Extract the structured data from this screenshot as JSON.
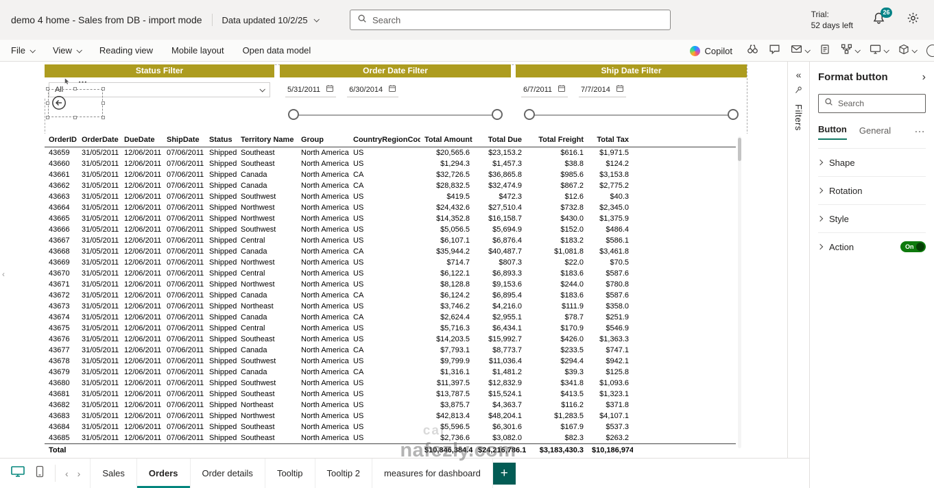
{
  "topbar": {
    "title": "demo 4 home - Sales from DB - import mode",
    "data_updated_label": "Data updated 10/2/25",
    "search_placeholder": "Search",
    "trial_line1": "Trial:",
    "trial_line2": "52 days left",
    "notification_count": "26"
  },
  "menubar": {
    "items": [
      {
        "label": "File",
        "dropdown": true
      },
      {
        "label": "View",
        "dropdown": true
      },
      {
        "label": "Reading view",
        "dropdown": false
      },
      {
        "label": "Mobile layout",
        "dropdown": false
      },
      {
        "label": "Open data model",
        "dropdown": false
      }
    ],
    "copilot_label": "Copilot"
  },
  "canvas": {
    "slicers": [
      {
        "title": "Status Filter",
        "value": "All"
      },
      {
        "title": "Order Date Filter",
        "start": "5/31/2011",
        "end": "6/30/2014"
      },
      {
        "title": "Ship Date Filter",
        "start": "6/7/2011",
        "end": "7/7/2014"
      }
    ],
    "table": {
      "columns": [
        "OrderID",
        "OrderDate",
        "DueDate",
        "ShipDate",
        "Status",
        "Territory Name",
        "Group",
        "CountryRegionCode",
        "Total Amount",
        "Total Due",
        "Total Freight",
        "Total Tax"
      ],
      "rows": [
        [
          "43659",
          "31/05/2011",
          "12/06/2011",
          "07/06/2011",
          "Shipped",
          "Southeast",
          "North America",
          "US",
          "$20,565.6",
          "$23,153.2",
          "$616.1",
          "$1,971.5"
        ],
        [
          "43660",
          "31/05/2011",
          "12/06/2011",
          "07/06/2011",
          "Shipped",
          "Southeast",
          "North America",
          "US",
          "$1,294.3",
          "$1,457.3",
          "$38.8",
          "$124.2"
        ],
        [
          "43661",
          "31/05/2011",
          "12/06/2011",
          "07/06/2011",
          "Shipped",
          "Canada",
          "North America",
          "CA",
          "$32,726.5",
          "$36,865.8",
          "$985.6",
          "$3,153.8"
        ],
        [
          "43662",
          "31/05/2011",
          "12/06/2011",
          "07/06/2011",
          "Shipped",
          "Canada",
          "North America",
          "CA",
          "$28,832.5",
          "$32,474.9",
          "$867.2",
          "$2,775.2"
        ],
        [
          "43663",
          "31/05/2011",
          "12/06/2011",
          "07/06/2011",
          "Shipped",
          "Southwest",
          "North America",
          "US",
          "$419.5",
          "$472.3",
          "$12.6",
          "$40.3"
        ],
        [
          "43664",
          "31/05/2011",
          "12/06/2011",
          "07/06/2011",
          "Shipped",
          "Northwest",
          "North America",
          "US",
          "$24,432.6",
          "$27,510.4",
          "$732.8",
          "$2,345.0"
        ],
        [
          "43665",
          "31/05/2011",
          "12/06/2011",
          "07/06/2011",
          "Shipped",
          "Northwest",
          "North America",
          "US",
          "$14,352.8",
          "$16,158.7",
          "$430.0",
          "$1,375.9"
        ],
        [
          "43666",
          "31/05/2011",
          "12/06/2011",
          "07/06/2011",
          "Shipped",
          "Southwest",
          "North America",
          "US",
          "$5,056.5",
          "$5,694.9",
          "$152.0",
          "$486.4"
        ],
        [
          "43667",
          "31/05/2011",
          "12/06/2011",
          "07/06/2011",
          "Shipped",
          "Central",
          "North America",
          "US",
          "$6,107.1",
          "$6,876.4",
          "$183.2",
          "$586.1"
        ],
        [
          "43668",
          "31/05/2011",
          "12/06/2011",
          "07/06/2011",
          "Shipped",
          "Canada",
          "North America",
          "CA",
          "$35,944.2",
          "$40,487.7",
          "$1,081.8",
          "$3,461.8"
        ],
        [
          "43669",
          "31/05/2011",
          "12/06/2011",
          "07/06/2011",
          "Shipped",
          "Northwest",
          "North America",
          "US",
          "$714.7",
          "$807.3",
          "$22.0",
          "$70.5"
        ],
        [
          "43670",
          "31/05/2011",
          "12/06/2011",
          "07/06/2011",
          "Shipped",
          "Central",
          "North America",
          "US",
          "$6,122.1",
          "$6,893.3",
          "$183.6",
          "$587.6"
        ],
        [
          "43671",
          "31/05/2011",
          "12/06/2011",
          "07/06/2011",
          "Shipped",
          "Northwest",
          "North America",
          "US",
          "$8,128.8",
          "$9,153.6",
          "$244.0",
          "$780.8"
        ],
        [
          "43672",
          "31/05/2011",
          "12/06/2011",
          "07/06/2011",
          "Shipped",
          "Canada",
          "North America",
          "CA",
          "$6,124.2",
          "$6,895.4",
          "$183.6",
          "$587.6"
        ],
        [
          "43673",
          "31/05/2011",
          "12/06/2011",
          "07/06/2011",
          "Shipped",
          "Northeast",
          "North America",
          "US",
          "$3,746.2",
          "$4,216.0",
          "$111.9",
          "$358.0"
        ],
        [
          "43674",
          "31/05/2011",
          "12/06/2011",
          "07/06/2011",
          "Shipped",
          "Canada",
          "North America",
          "CA",
          "$2,624.4",
          "$2,955.1",
          "$78.7",
          "$251.9"
        ],
        [
          "43675",
          "31/05/2011",
          "12/06/2011",
          "07/06/2011",
          "Shipped",
          "Central",
          "North America",
          "US",
          "$5,716.3",
          "$6,434.1",
          "$170.9",
          "$546.9"
        ],
        [
          "43676",
          "31/05/2011",
          "12/06/2011",
          "07/06/2011",
          "Shipped",
          "Southeast",
          "North America",
          "US",
          "$14,203.5",
          "$15,992.7",
          "$426.0",
          "$1,363.3"
        ],
        [
          "43677",
          "31/05/2011",
          "12/06/2011",
          "07/06/2011",
          "Shipped",
          "Canada",
          "North America",
          "CA",
          "$7,793.1",
          "$8,773.7",
          "$233.5",
          "$747.1"
        ],
        [
          "43678",
          "31/05/2011",
          "12/06/2011",
          "07/06/2011",
          "Shipped",
          "Southwest",
          "North America",
          "US",
          "$9,799.9",
          "$11,036.4",
          "$294.4",
          "$942.1"
        ],
        [
          "43679",
          "31/05/2011",
          "12/06/2011",
          "07/06/2011",
          "Shipped",
          "Canada",
          "North America",
          "CA",
          "$1,316.1",
          "$1,481.2",
          "$39.3",
          "$125.8"
        ],
        [
          "43680",
          "31/05/2011",
          "12/06/2011",
          "07/06/2011",
          "Shipped",
          "Southwest",
          "North America",
          "US",
          "$11,397.5",
          "$12,832.9",
          "$341.8",
          "$1,093.6"
        ],
        [
          "43681",
          "31/05/2011",
          "12/06/2011",
          "07/06/2011",
          "Shipped",
          "Southeast",
          "North America",
          "US",
          "$13,787.5",
          "$15,524.1",
          "$413.5",
          "$1,323.1"
        ],
        [
          "43682",
          "31/05/2011",
          "12/06/2011",
          "07/06/2011",
          "Shipped",
          "Northeast",
          "North America",
          "US",
          "$3,875.7",
          "$4,363.7",
          "$116.2",
          "$371.8"
        ],
        [
          "43683",
          "31/05/2011",
          "12/06/2011",
          "07/06/2011",
          "Shipped",
          "Northwest",
          "North America",
          "US",
          "$42,813.4",
          "$48,204.1",
          "$1,283.5",
          "$4,107.1"
        ],
        [
          "43684",
          "31/05/2011",
          "12/06/2011",
          "07/06/2011",
          "Shipped",
          "Southeast",
          "North America",
          "US",
          "$5,596.5",
          "$6,301.6",
          "$167.9",
          "$537.3"
        ],
        [
          "43685",
          "31/05/2011",
          "12/06/2011",
          "07/06/2011",
          "Shipped",
          "Southeast",
          "North America",
          "US",
          "$2,736.6",
          "$3,082.0",
          "$82.3",
          "$263.2"
        ]
      ],
      "total_label": "Total",
      "total_amount": "$10,846,384.4",
      "total_due": "$24,216,786.1",
      "total_freight": "$3,183,430.3",
      "total_tax": "$10,186,974.5"
    }
  },
  "filters_pane": {
    "label": "Filters"
  },
  "format_pane": {
    "title": "Format button",
    "search_placeholder": "Search",
    "tabs": [
      {
        "label": "Button",
        "active": true
      },
      {
        "label": "General",
        "active": false
      }
    ],
    "overflow": "…",
    "sections": [
      {
        "label": "Shape"
      },
      {
        "label": "Rotation"
      },
      {
        "label": "Style"
      },
      {
        "label": "Action",
        "toggle": "On"
      }
    ]
  },
  "pages": {
    "tabs": [
      "Sales",
      "Orders",
      "Order details",
      "Tooltip",
      "Tooltip 2",
      "measures for dashboard"
    ],
    "active": "Orders",
    "add_label": "+"
  },
  "watermark": {
    "faint": "cal",
    "text": "nafezly.com"
  },
  "colors": {
    "gold": "#ad9c1f",
    "teal": "#03857c",
    "dark_teal": "#035c55",
    "green": "#0e7a0d"
  }
}
